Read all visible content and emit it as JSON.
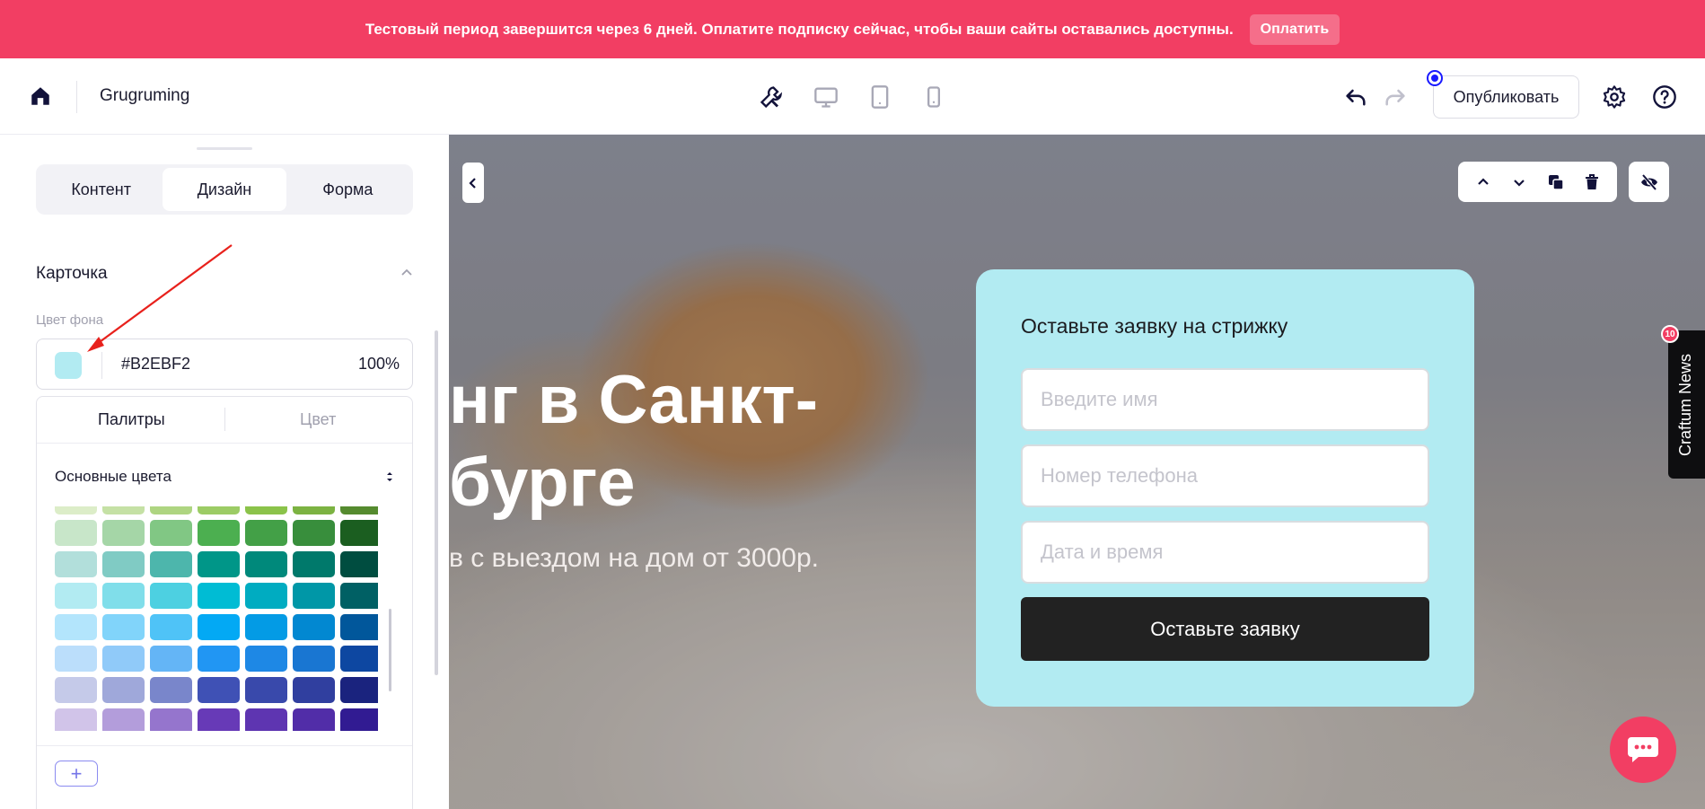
{
  "banner": {
    "message": "Тестовый период завершится через 6 дней. Оплатите подписку сейчас, чтобы ваши сайты оставались доступны.",
    "pay_label": "Оплатить"
  },
  "topbar": {
    "site_name": "Grugruming",
    "publish_label": "Опубликовать",
    "icons": [
      "home-icon",
      "tools-icon",
      "desktop-icon",
      "tablet-icon",
      "mobile-icon",
      "undo-icon",
      "redo-icon",
      "settings-icon",
      "help-icon"
    ]
  },
  "panel": {
    "tabs": [
      "Контент",
      "Дизайн",
      "Форма"
    ],
    "active_tab": "Дизайн",
    "section_title": "Карточка",
    "field_label": "Цвет фона",
    "color": {
      "hex": "#B2EBF2",
      "opacity": "100%"
    },
    "picker": {
      "tabs": [
        "Палитры",
        "Цвет"
      ],
      "palette_name": "Основные цвета",
      "rows": [
        [
          "#dcedc8",
          "#c5e1a5",
          "#aed581",
          "#9ccc65",
          "#8bc34a",
          "#7cb342",
          "#558b2f"
        ],
        [
          "#c8e6c9",
          "#a5d6a7",
          "#81c784",
          "#4caf50",
          "#43a047",
          "#388e3c",
          "#1b5e20"
        ],
        [
          "#b2dfdb",
          "#80cbc4",
          "#4db6ac",
          "#009688",
          "#00897b",
          "#00796b",
          "#004d40"
        ],
        [
          "#b2ebf2",
          "#80deea",
          "#4dd0e1",
          "#00bcd4",
          "#00acc1",
          "#0097a7",
          "#006064"
        ],
        [
          "#b3e5fc",
          "#81d4fa",
          "#4fc3f7",
          "#03a9f4",
          "#039be5",
          "#0288d1",
          "#01579b"
        ],
        [
          "#bbdefb",
          "#90caf9",
          "#64b5f6",
          "#2196f3",
          "#1e88e5",
          "#1976d2",
          "#0d47a1"
        ],
        [
          "#c5cae9",
          "#9fa8da",
          "#7986cb",
          "#3f51b5",
          "#3949ab",
          "#303f9f",
          "#1a237e"
        ],
        [
          "#d1c4e9",
          "#b39ddb",
          "#9575cd",
          "#673ab7",
          "#5e35b1",
          "#512da8",
          "#311b92"
        ]
      ],
      "add_label": "+"
    }
  },
  "canvas": {
    "hero_title_line1": "нг в Санкт-",
    "hero_title_line2": "бурге",
    "hero_subtitle": "в с выездом на дом от 3000р.",
    "form": {
      "title": "Оставьте заявку на стрижку",
      "name_placeholder": "Введите имя",
      "phone_placeholder": "Номер телефона",
      "datetime_placeholder": "Дата и время",
      "submit_label": "Оставьте заявку",
      "background": "#b2ebf2"
    },
    "news_label": "Craftum News",
    "news_badge": "10"
  },
  "colors": {
    "brand": "#f23e63",
    "accent_blue": "#1a1aff",
    "dark_button": "#222222"
  }
}
